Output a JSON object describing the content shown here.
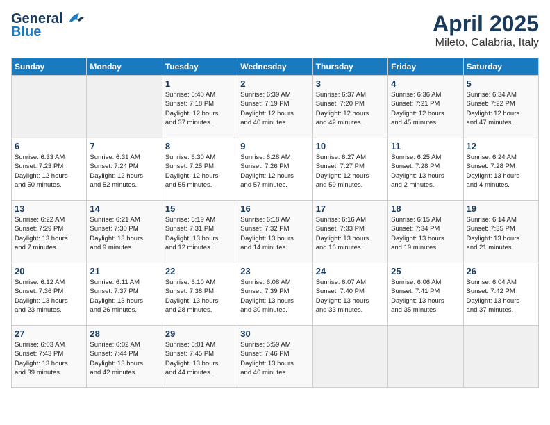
{
  "header": {
    "logo_general": "General",
    "logo_blue": "Blue",
    "month": "April 2025",
    "location": "Mileto, Calabria, Italy"
  },
  "days_of_week": [
    "Sunday",
    "Monday",
    "Tuesday",
    "Wednesday",
    "Thursday",
    "Friday",
    "Saturday"
  ],
  "weeks": [
    [
      {
        "day": "",
        "info": ""
      },
      {
        "day": "",
        "info": ""
      },
      {
        "day": "1",
        "info": "Sunrise: 6:40 AM\nSunset: 7:18 PM\nDaylight: 12 hours\nand 37 minutes."
      },
      {
        "day": "2",
        "info": "Sunrise: 6:39 AM\nSunset: 7:19 PM\nDaylight: 12 hours\nand 40 minutes."
      },
      {
        "day": "3",
        "info": "Sunrise: 6:37 AM\nSunset: 7:20 PM\nDaylight: 12 hours\nand 42 minutes."
      },
      {
        "day": "4",
        "info": "Sunrise: 6:36 AM\nSunset: 7:21 PM\nDaylight: 12 hours\nand 45 minutes."
      },
      {
        "day": "5",
        "info": "Sunrise: 6:34 AM\nSunset: 7:22 PM\nDaylight: 12 hours\nand 47 minutes."
      }
    ],
    [
      {
        "day": "6",
        "info": "Sunrise: 6:33 AM\nSunset: 7:23 PM\nDaylight: 12 hours\nand 50 minutes."
      },
      {
        "day": "7",
        "info": "Sunrise: 6:31 AM\nSunset: 7:24 PM\nDaylight: 12 hours\nand 52 minutes."
      },
      {
        "day": "8",
        "info": "Sunrise: 6:30 AM\nSunset: 7:25 PM\nDaylight: 12 hours\nand 55 minutes."
      },
      {
        "day": "9",
        "info": "Sunrise: 6:28 AM\nSunset: 7:26 PM\nDaylight: 12 hours\nand 57 minutes."
      },
      {
        "day": "10",
        "info": "Sunrise: 6:27 AM\nSunset: 7:27 PM\nDaylight: 12 hours\nand 59 minutes."
      },
      {
        "day": "11",
        "info": "Sunrise: 6:25 AM\nSunset: 7:28 PM\nDaylight: 13 hours\nand 2 minutes."
      },
      {
        "day": "12",
        "info": "Sunrise: 6:24 AM\nSunset: 7:28 PM\nDaylight: 13 hours\nand 4 minutes."
      }
    ],
    [
      {
        "day": "13",
        "info": "Sunrise: 6:22 AM\nSunset: 7:29 PM\nDaylight: 13 hours\nand 7 minutes."
      },
      {
        "day": "14",
        "info": "Sunrise: 6:21 AM\nSunset: 7:30 PM\nDaylight: 13 hours\nand 9 minutes."
      },
      {
        "day": "15",
        "info": "Sunrise: 6:19 AM\nSunset: 7:31 PM\nDaylight: 13 hours\nand 12 minutes."
      },
      {
        "day": "16",
        "info": "Sunrise: 6:18 AM\nSunset: 7:32 PM\nDaylight: 13 hours\nand 14 minutes."
      },
      {
        "day": "17",
        "info": "Sunrise: 6:16 AM\nSunset: 7:33 PM\nDaylight: 13 hours\nand 16 minutes."
      },
      {
        "day": "18",
        "info": "Sunrise: 6:15 AM\nSunset: 7:34 PM\nDaylight: 13 hours\nand 19 minutes."
      },
      {
        "day": "19",
        "info": "Sunrise: 6:14 AM\nSunset: 7:35 PM\nDaylight: 13 hours\nand 21 minutes."
      }
    ],
    [
      {
        "day": "20",
        "info": "Sunrise: 6:12 AM\nSunset: 7:36 PM\nDaylight: 13 hours\nand 23 minutes."
      },
      {
        "day": "21",
        "info": "Sunrise: 6:11 AM\nSunset: 7:37 PM\nDaylight: 13 hours\nand 26 minutes."
      },
      {
        "day": "22",
        "info": "Sunrise: 6:10 AM\nSunset: 7:38 PM\nDaylight: 13 hours\nand 28 minutes."
      },
      {
        "day": "23",
        "info": "Sunrise: 6:08 AM\nSunset: 7:39 PM\nDaylight: 13 hours\nand 30 minutes."
      },
      {
        "day": "24",
        "info": "Sunrise: 6:07 AM\nSunset: 7:40 PM\nDaylight: 13 hours\nand 33 minutes."
      },
      {
        "day": "25",
        "info": "Sunrise: 6:06 AM\nSunset: 7:41 PM\nDaylight: 13 hours\nand 35 minutes."
      },
      {
        "day": "26",
        "info": "Sunrise: 6:04 AM\nSunset: 7:42 PM\nDaylight: 13 hours\nand 37 minutes."
      }
    ],
    [
      {
        "day": "27",
        "info": "Sunrise: 6:03 AM\nSunset: 7:43 PM\nDaylight: 13 hours\nand 39 minutes."
      },
      {
        "day": "28",
        "info": "Sunrise: 6:02 AM\nSunset: 7:44 PM\nDaylight: 13 hours\nand 42 minutes."
      },
      {
        "day": "29",
        "info": "Sunrise: 6:01 AM\nSunset: 7:45 PM\nDaylight: 13 hours\nand 44 minutes."
      },
      {
        "day": "30",
        "info": "Sunrise: 5:59 AM\nSunset: 7:46 PM\nDaylight: 13 hours\nand 46 minutes."
      },
      {
        "day": "",
        "info": ""
      },
      {
        "day": "",
        "info": ""
      },
      {
        "day": "",
        "info": ""
      }
    ]
  ]
}
